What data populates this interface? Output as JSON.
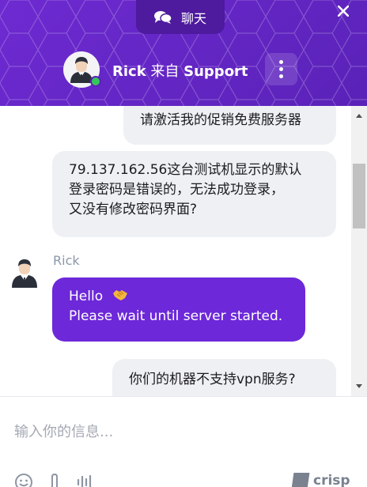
{
  "header": {
    "tab_label": "聊天",
    "agent_name": "Rick",
    "agent_from": "来自",
    "agent_team": "Support",
    "accent_color": "#6d2ad1",
    "status_color": "#35c759"
  },
  "icons": {
    "chat": "chat-bubbles-icon",
    "close": "close-icon",
    "menu": "more-vertical-icon",
    "emoji": "smile-icon",
    "attach": "paperclip-icon",
    "audio": "audio-wave-icon"
  },
  "messages": [
    {
      "from": "user",
      "text": "请激活我的促销免费服务器"
    },
    {
      "from": "user",
      "text": "79.137.162.56这台测试机显示的默认\n登录密码是错误的，无法成功登录，\n又没有修改密码界面?"
    },
    {
      "from": "operator",
      "sender": "Rick",
      "text": "Hello",
      "line2": "Please wait until server started."
    },
    {
      "from": "user",
      "text": "你们的机器不支持vpn服务?"
    }
  ],
  "composer": {
    "placeholder": "输入你的信息...",
    "brand": "crisp"
  }
}
